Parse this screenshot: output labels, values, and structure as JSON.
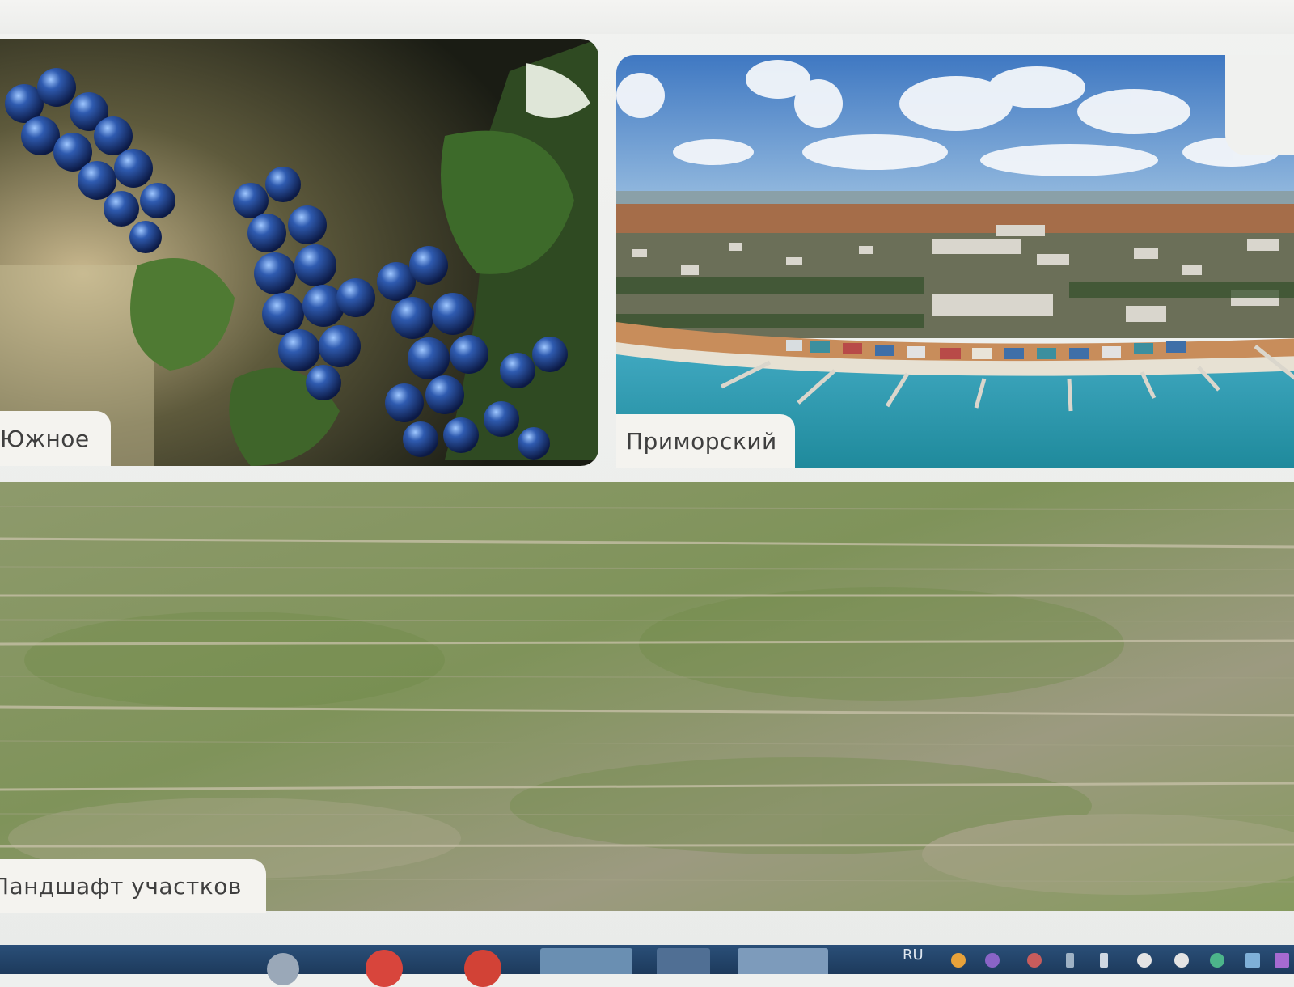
{
  "cards": [
    {
      "label": "Южное"
    },
    {
      "label": "Приморский"
    },
    {
      "label": "Ландшафт участков"
    }
  ],
  "taskbar": {
    "language": "RU"
  }
}
